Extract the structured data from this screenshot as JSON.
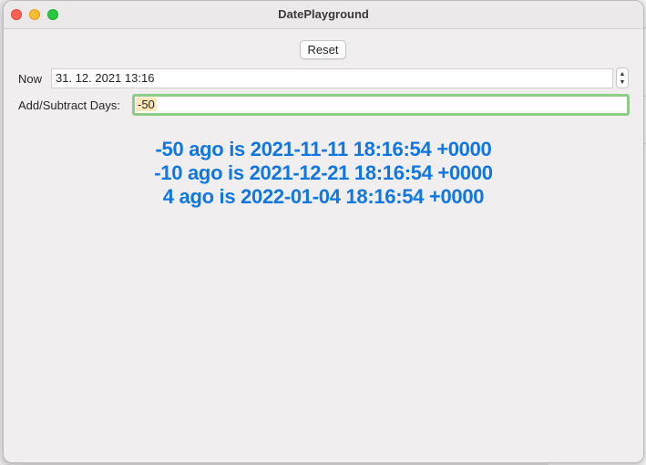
{
  "window": {
    "title": "DatePlayground"
  },
  "toolbar": {
    "reset_label": "Reset"
  },
  "now": {
    "label": "Now",
    "value": "31. 12. 2021 13:16"
  },
  "days": {
    "label": "Add/Subtract Days:",
    "value": "-50"
  },
  "results": [
    "-50 ago is 2021-11-11 18:16:54 +0000",
    "-10 ago is 2021-12-21 18:16:54 +0000",
    "4 ago is 2022-01-04 18:16:54 +0000"
  ],
  "colors": {
    "accent": "#1177e0",
    "focus_ring": "#8fcd87",
    "close": "#fe5f57",
    "minimize": "#febc2e",
    "maximize": "#28c840"
  }
}
